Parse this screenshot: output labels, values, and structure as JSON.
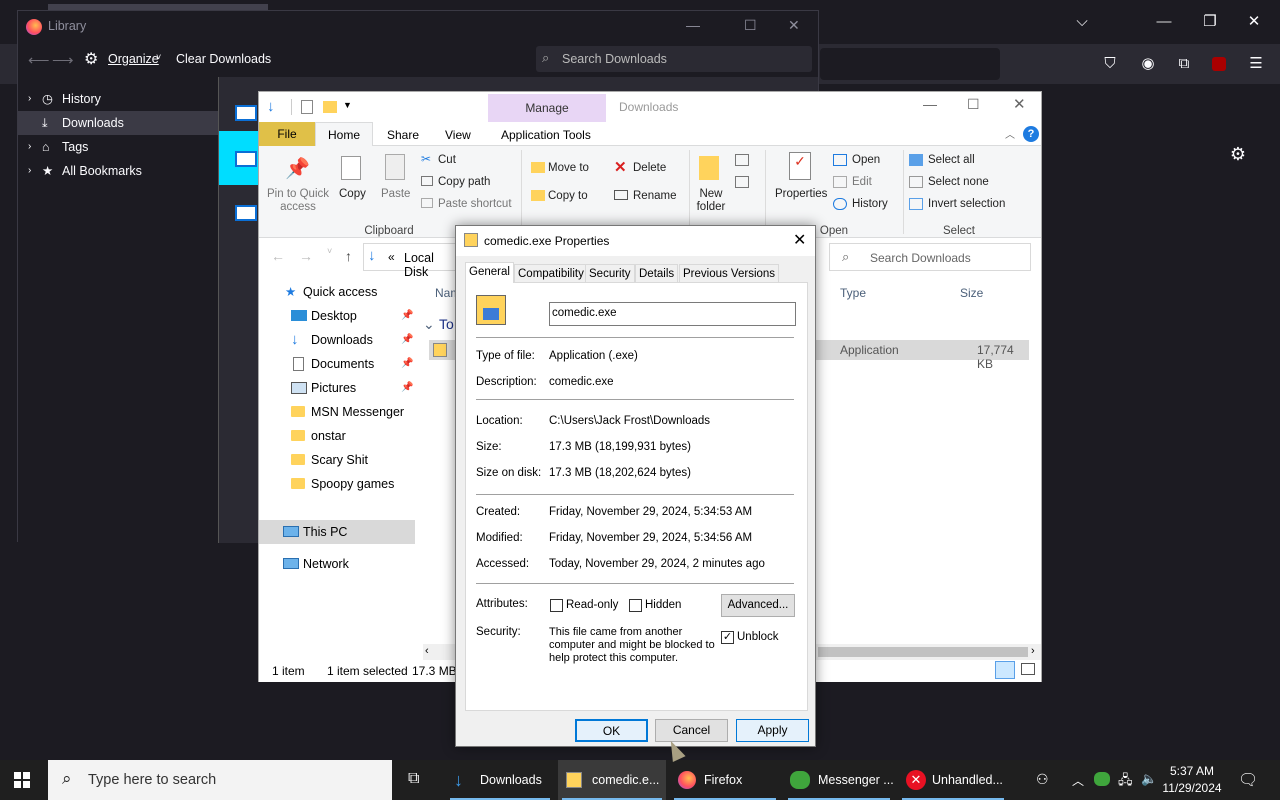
{
  "colors": {
    "accent": "#0078d7",
    "ribbon_manage": "#e8d6f5",
    "dlg_bg": "#f0f0f0",
    "taskbar": "#1f1f1f"
  },
  "library": {
    "title": "Library",
    "organize": "Organize",
    "clear_downloads": "Clear Downloads",
    "search_placeholder": "Search Downloads",
    "sidebar": [
      {
        "label": "History",
        "icon": "history-icon"
      },
      {
        "label": "Downloads",
        "icon": "download-icon"
      },
      {
        "label": "Tags",
        "icon": "tag-icon"
      },
      {
        "label": "All Bookmarks",
        "icon": "star-icon"
      }
    ]
  },
  "explorer": {
    "title": "Downloads",
    "manage_tab": "Manage",
    "tabs": [
      "File",
      "Home",
      "Share",
      "View",
      "Application Tools"
    ],
    "ribbon": {
      "pin": "Pin to Quick access",
      "copy": "Copy",
      "paste": "Paste",
      "cut": "Cut",
      "copy_path": "Copy path",
      "paste_shortcut": "Paste shortcut",
      "clipboard": "Clipboard",
      "move_to": "Move to",
      "copy_to": "Copy to",
      "delete": "Delete",
      "rename": "Rename",
      "new_folder": "New folder",
      "properties": "Properties",
      "open": "Open",
      "edit": "Edit",
      "history": "History",
      "open_group": "Open",
      "select_all": "Select all",
      "select_none": "Select none",
      "invert_selection": "Invert selection",
      "select_group": "Select"
    },
    "address": "Local Disk",
    "search_placeholder": "Search Downloads",
    "columns": {
      "name": "Nam",
      "type": "Type",
      "size": "Size"
    },
    "group_label": "To",
    "file": {
      "type": "Application",
      "size": "17,774 KB"
    },
    "nav": [
      {
        "label": "Quick access",
        "pinned": false
      },
      {
        "label": "Desktop",
        "pinned": true
      },
      {
        "label": "Downloads",
        "pinned": true
      },
      {
        "label": "Documents",
        "pinned": true
      },
      {
        "label": "Pictures",
        "pinned": true
      },
      {
        "label": "MSN Messenger",
        "pinned": false
      },
      {
        "label": "onstar",
        "pinned": false
      },
      {
        "label": "Scary Shit",
        "pinned": false
      },
      {
        "label": "Spoopy games",
        "pinned": false
      },
      {
        "label": "This PC",
        "pinned": false
      },
      {
        "label": "Network",
        "pinned": false
      }
    ],
    "status": {
      "count": "1 item",
      "selected": "1 item selected",
      "size": "17.3 MB"
    }
  },
  "dialog": {
    "title": "comedic.exe Properties",
    "tabs": [
      "General",
      "Compatibility",
      "Security",
      "Details",
      "Previous Versions"
    ],
    "filename": "comedic.exe",
    "type_label": "Type of file:",
    "type_value": "Application (.exe)",
    "desc_label": "Description:",
    "desc_value": "comedic.exe",
    "loc_label": "Location:",
    "loc_value": "C:\\Users\\Jack Frost\\Downloads",
    "size_label": "Size:",
    "size_value": "17.3 MB (18,199,931 bytes)",
    "sod_label": "Size on disk:",
    "sod_value": "17.3 MB (18,202,624 bytes)",
    "created_label": "Created:",
    "created_value": "Friday, November 29, 2024, 5:34:53 AM",
    "modified_label": "Modified:",
    "modified_value": "Friday, November 29, 2024, 5:34:56 AM",
    "accessed_label": "Accessed:",
    "accessed_value": "Today, November 29, 2024, 2 minutes ago",
    "attr_label": "Attributes:",
    "readonly": "Read-only",
    "hidden": "Hidden",
    "advanced": "Advanced...",
    "security_label": "Security:",
    "security_line1": "This file came from another",
    "security_line2": "computer and might be blocked to",
    "security_line3": "help protect this computer.",
    "unblock": "Unblock",
    "ok": "OK",
    "cancel": "Cancel",
    "apply": "Apply"
  },
  "taskbar": {
    "search_placeholder": "Type here to search",
    "apps": [
      {
        "label": "Downloads"
      },
      {
        "label": "comedic.e..."
      },
      {
        "label": "Firefox"
      },
      {
        "label": "Messenger ..."
      },
      {
        "label": "Unhandled..."
      }
    ],
    "time": "5:37 AM",
    "date": "11/29/2024"
  }
}
